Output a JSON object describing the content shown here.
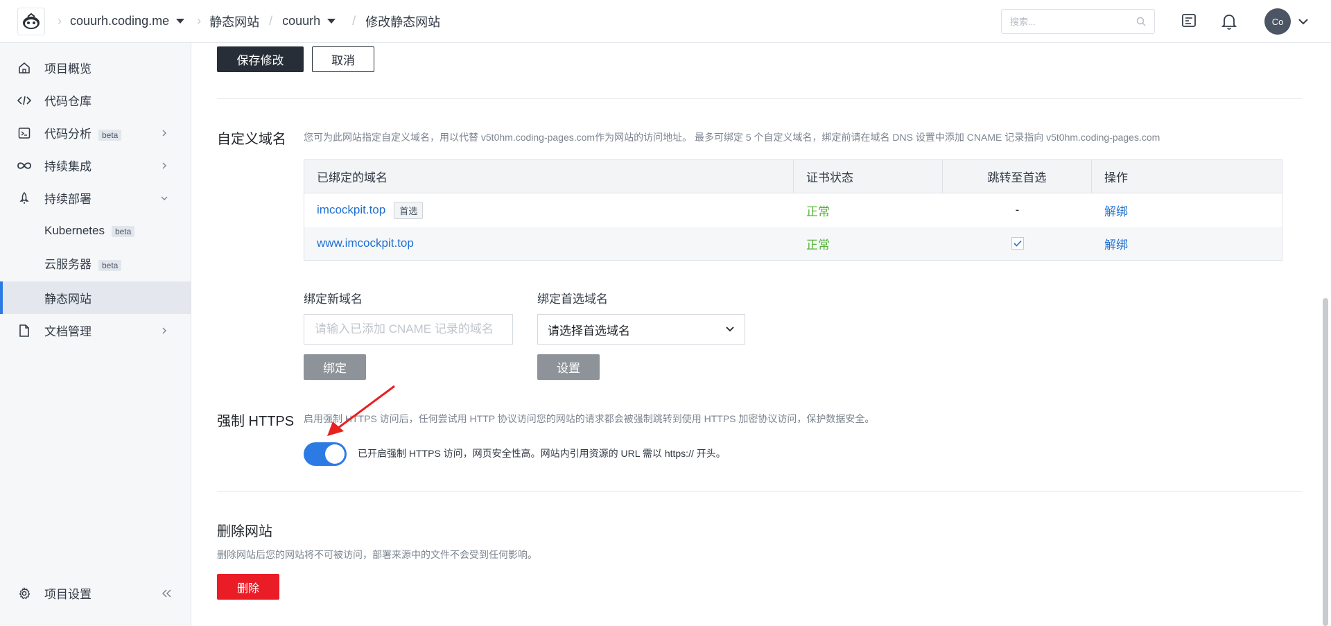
{
  "header": {
    "crumbs": [
      "couurh.coding.me",
      "静态网站",
      "couurh",
      "修改静态网站"
    ],
    "search_placeholder": "搜索...",
    "avatar_text": "Co"
  },
  "sidebar": {
    "items": [
      {
        "label": "项目概览",
        "icon": "home-icon"
      },
      {
        "label": "代码仓库",
        "icon": "code-icon"
      },
      {
        "label": "代码分析",
        "badge": "beta",
        "icon": "terminal-icon"
      },
      {
        "label": "持续集成",
        "icon": "infinity-icon"
      },
      {
        "label": "持续部署",
        "icon": "rocket-icon"
      },
      {
        "label": "Kubernetes",
        "badge": "beta"
      },
      {
        "label": "云服务器",
        "badge": "beta"
      },
      {
        "label": "静态网站"
      },
      {
        "label": "文档管理",
        "icon": "document-icon"
      }
    ],
    "settings_label": "项目设置"
  },
  "actions": {
    "save": "保存修改",
    "cancel": "取消"
  },
  "domain": {
    "title": "自定义域名",
    "description": "您可为此网站指定自定义域名，用以代替 v5t0hm.coding-pages.com作为网站的访问地址。 最多可绑定 5 个自定义域名，绑定前请在域名 DNS 设置中添加 CNAME 记录指向 v5t0hm.coding-pages.com",
    "columns": [
      "已绑定的域名",
      "证书状态",
      "跳转至首选",
      "操作"
    ],
    "rows": [
      {
        "domain": "imcockpit.top",
        "tag": "首选",
        "status": "正常",
        "redirect": "-",
        "action": "解绑"
      },
      {
        "domain": "www.imcockpit.top",
        "tag": "",
        "status": "正常",
        "redirect": "checked",
        "action": "解绑"
      }
    ],
    "bind_label": "绑定新域名",
    "bind_placeholder": "请输入已添加 CNAME 记录的域名",
    "bind_button": "绑定",
    "preferred_label": "绑定首选域名",
    "preferred_select": "请选择首选域名",
    "preferred_button": "设置"
  },
  "https": {
    "title": "强制 HTTPS",
    "description": "启用强制 HTTPS 访问后，任何尝试用 HTTP 协议访问您的网站的请求都会被强制跳转到使用 HTTPS 加密协议访问，保护数据安全。",
    "enabled": true,
    "toggle_text": "已开启强制 HTTPS 访问，网页安全性高。网站内引用资源的 URL 需以 https:// 开头。"
  },
  "delete": {
    "title": "删除网站",
    "description": "删除网站后您的网站将不可被访问，部署来源中的文件不会受到任何影响。",
    "button": "删除"
  },
  "colors": {
    "accent": "#2c7be5",
    "danger": "#ea1c25",
    "success": "#52b033",
    "annotation_arrow": "#e8201f"
  }
}
